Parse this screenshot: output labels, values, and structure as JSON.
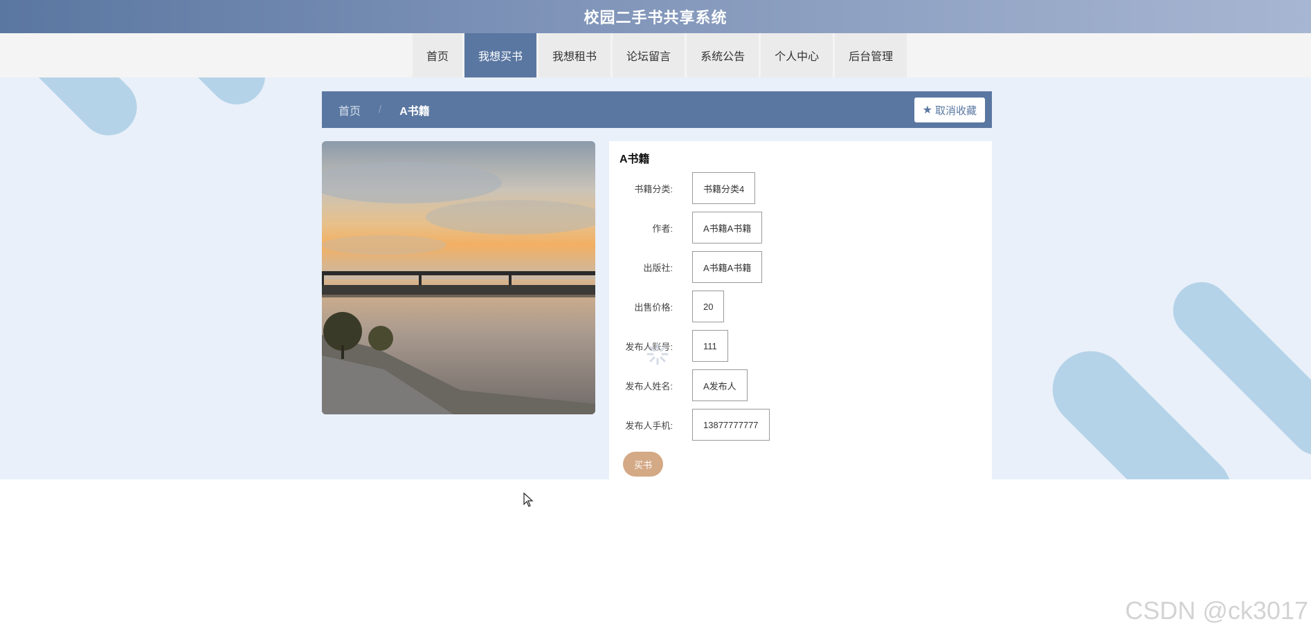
{
  "app": {
    "title": "校园二手书共享系统"
  },
  "nav": {
    "items": [
      {
        "label": "首页"
      },
      {
        "label": "我想买书",
        "active": true
      },
      {
        "label": "我想租书"
      },
      {
        "label": "论坛留言"
      },
      {
        "label": "系统公告"
      },
      {
        "label": "个人中心"
      },
      {
        "label": "后台管理"
      }
    ]
  },
  "breadcrumb": {
    "home": "首页",
    "separator": "/",
    "current": "A书籍"
  },
  "favorite_button": {
    "icon": "star-icon",
    "label": "取消收藏"
  },
  "book": {
    "title": "A书籍",
    "fields": [
      {
        "label": "书籍分类:",
        "value": "书籍分类4"
      },
      {
        "label": "作者:",
        "value": "A书籍A书籍"
      },
      {
        "label": "出版社:",
        "value": "A书籍A书籍"
      },
      {
        "label": "出售价格:",
        "value": "20"
      },
      {
        "label": "发布人账号:",
        "value": "111"
      },
      {
        "label": "发布人姓名:",
        "value": "A发布人"
      },
      {
        "label": "发布人手机:",
        "value": "13877777777"
      }
    ],
    "buy_label": "买书"
  },
  "watermark": "CSDN @ck3017",
  "colors": {
    "primary": "#5a77a1",
    "buy_button": "#d4a985",
    "page_bg": "#e9f0fa",
    "decoration": "#b5d3e8"
  }
}
